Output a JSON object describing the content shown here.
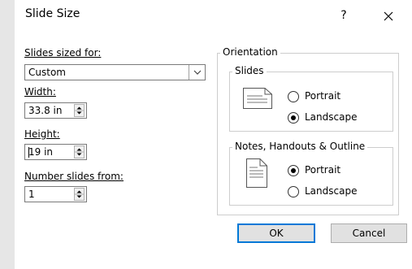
{
  "dialog": {
    "title": "Slide Size",
    "help_label": "?"
  },
  "left": {
    "sized_for_label": "Slides sized for:",
    "sized_for_value": "Custom",
    "width_label": "Width:",
    "width_value": "33.8 in",
    "height_label": "Height:",
    "height_value": "19 in",
    "number_from_label": "Number slides from:",
    "number_from_value": "1"
  },
  "orientation": {
    "title": "Orientation",
    "slides": {
      "title": "Slides",
      "portrait_label": "Portrait",
      "landscape_label": "Landscape",
      "selected": "landscape"
    },
    "notes": {
      "title": "Notes, Handouts & Outline",
      "portrait_label": "Portrait",
      "landscape_label": "Landscape",
      "selected": "portrait"
    }
  },
  "buttons": {
    "ok_label": "OK",
    "cancel_label": "Cancel"
  }
}
